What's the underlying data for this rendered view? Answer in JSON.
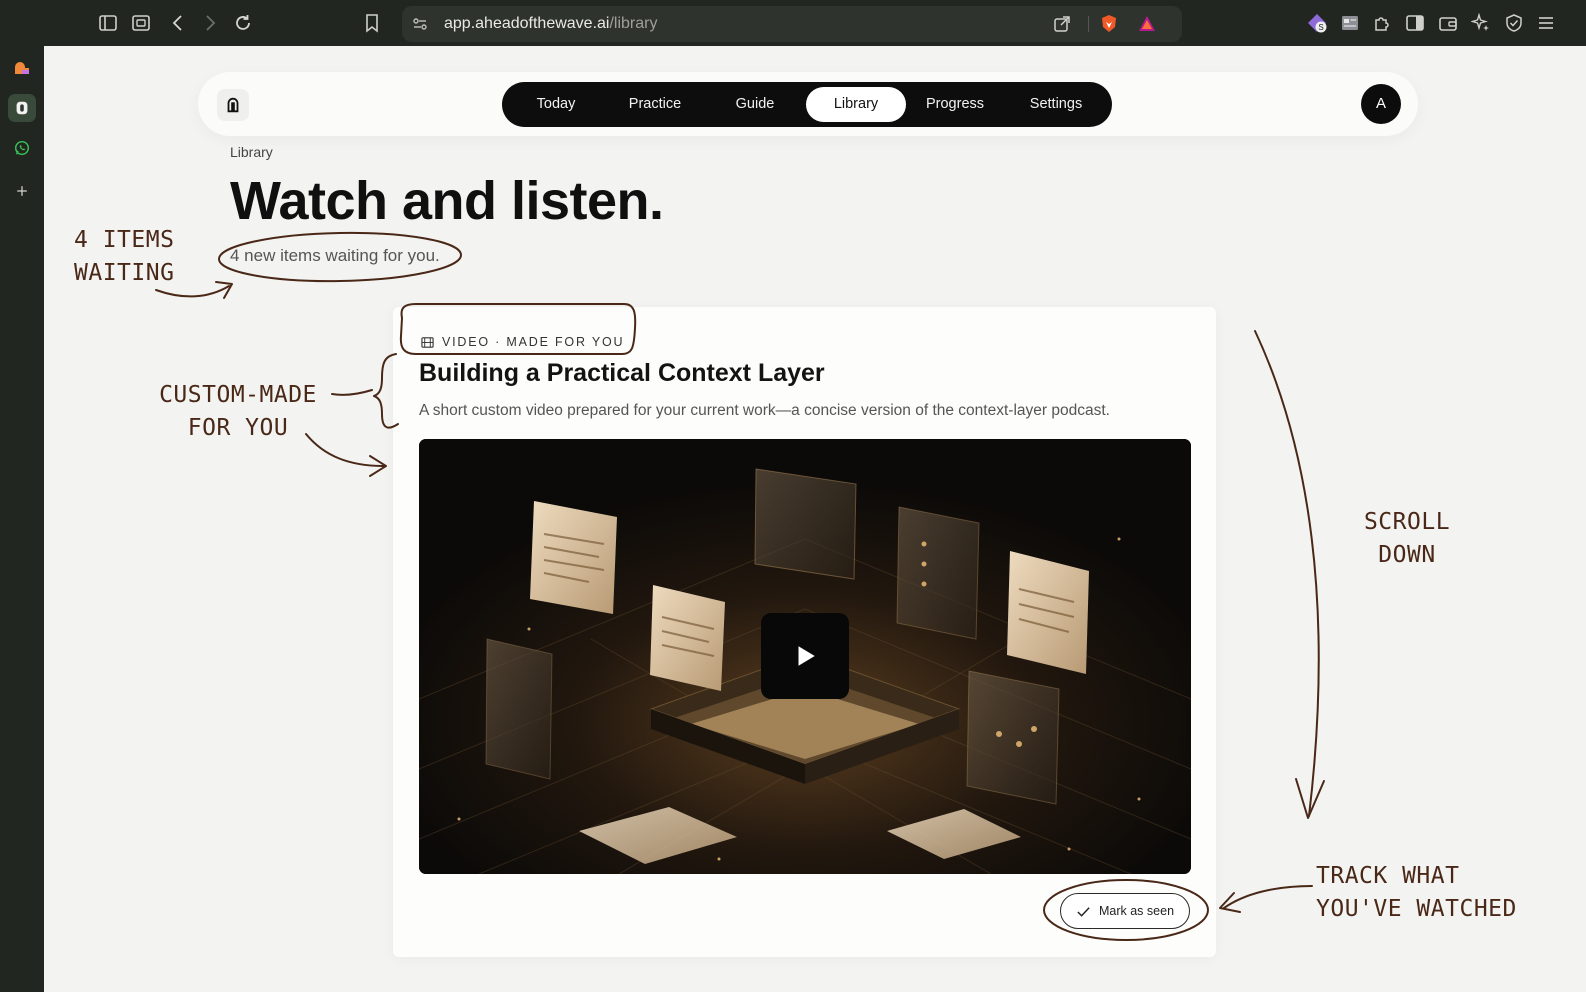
{
  "browser": {
    "url_host": "app.aheadofthewave.ai",
    "url_path": "/library"
  },
  "nav": {
    "tabs": [
      {
        "label": "Today"
      },
      {
        "label": "Practice"
      },
      {
        "label": "Guide"
      },
      {
        "label": "Library",
        "active": true
      },
      {
        "label": "Progress"
      },
      {
        "label": "Settings"
      }
    ],
    "avatar": "A"
  },
  "page": {
    "breadcrumb": "Library",
    "title": "Watch and listen.",
    "subtitle": "4 new items waiting for you."
  },
  "card": {
    "tag": "Video · Made for you",
    "title": "Building a Practical Context Layer",
    "description": "A short custom video prepared for your current work—a concise version of the context-layer podcast.",
    "mark_seen_label": "Mark as seen"
  },
  "annotations": {
    "items_waiting": [
      "4 items",
      "waiting"
    ],
    "custom_made": [
      "Custom-made",
      "for you"
    ],
    "scroll_down": [
      "Scroll",
      "down"
    ],
    "track_watched": [
      "Track what",
      "you've watched"
    ]
  },
  "colors": {
    "annotation_ink": "#4a2818",
    "accent_dark": "#0d0d0d",
    "page_bg": "#f3f3f1"
  }
}
